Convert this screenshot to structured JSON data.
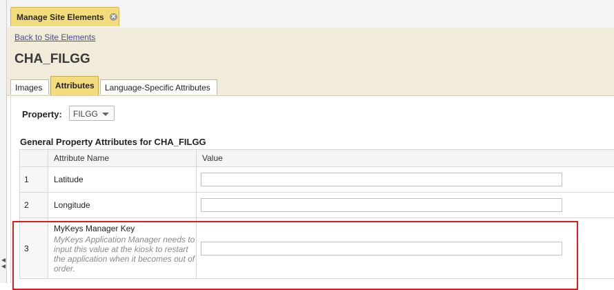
{
  "window": {
    "tab_label": "Manage Site Elements",
    "close_icon": "close-icon"
  },
  "header": {
    "back_link": "Back to Site Elements",
    "title": "CHA_FILGG"
  },
  "subtabs": [
    {
      "label": "Images",
      "active": false
    },
    {
      "label": "Attributes",
      "active": true
    },
    {
      "label": "Language-Specific Attributes",
      "active": false
    }
  ],
  "property": {
    "label": "Property:",
    "selected": "FILGG"
  },
  "section": {
    "title": "General Property Attributes for CHA_FILGG"
  },
  "table": {
    "columns": [
      "",
      "Attribute Name",
      "Value"
    ],
    "rows": [
      {
        "num": "1",
        "name": "Latitude",
        "description": "",
        "value": ""
      },
      {
        "num": "2",
        "name": "Longitude",
        "description": "",
        "value": ""
      },
      {
        "num": "3",
        "name": "MyKeys Manager Key",
        "description": "MyKeys Application Manager needs to input this value at the kiosk to restart the application when it becomes out of order.",
        "value": ""
      }
    ]
  },
  "colors": {
    "accent_tab": "#f2dc7e",
    "header_bg": "#f1ecd9",
    "highlight": "#e01b1b"
  }
}
